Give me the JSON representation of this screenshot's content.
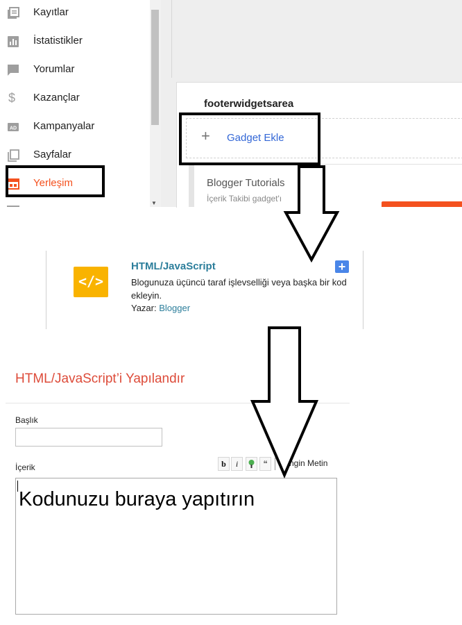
{
  "sidebar": {
    "items": [
      {
        "label": "Kayıtlar",
        "icon": "posts-icon",
        "active": false
      },
      {
        "label": "İstatistikler",
        "icon": "stats-icon",
        "active": false
      },
      {
        "label": "Yorumlar",
        "icon": "comments-icon",
        "active": false
      },
      {
        "label": "Kazançlar",
        "icon": "dollar-icon",
        "active": false
      },
      {
        "label": "Kampanyalar",
        "icon": "ad-icon",
        "active": false
      },
      {
        "label": "Sayfalar",
        "icon": "pages-icon",
        "active": false
      },
      {
        "label": "Yerleşim",
        "icon": "layout-icon",
        "active": true
      }
    ],
    "active_color": "#f4511e"
  },
  "layout": {
    "section_title": "footerwidgetsarea",
    "add_gadget_label": "Gadget Ekle",
    "gadget": {
      "title": "Blogger Tutorials",
      "subtitle": "İçerik Takibi gadget'ı"
    }
  },
  "gadget_list": {
    "title": "HTML/JavaScript",
    "description": "Blogunuza üçüncü taraf işlevselliği veya başka bir kod ekleyin.",
    "author_label": "Yazar:",
    "author_name": "Blogger",
    "icon": "code-icon",
    "icon_glyph": "</>",
    "add_icon": "plus-icon",
    "add_glyph": "+"
  },
  "config": {
    "title": "HTML/JavaScript’i Yapılandır",
    "title_field_label": "Başlık",
    "title_field_value": "",
    "content_label": "İçerik",
    "toolbar": {
      "bold": "b",
      "italic": "i",
      "quote": "❝",
      "rich_text": "Zengin Metin"
    },
    "content_value": "Kodunuzu buraya yapıtırın"
  },
  "colors": {
    "accent": "#f4511e",
    "link": "#3367d6",
    "gadget_title": "#2c7e9b",
    "code_icon_bg": "#f9b300",
    "config_title": "#dd4b39"
  }
}
